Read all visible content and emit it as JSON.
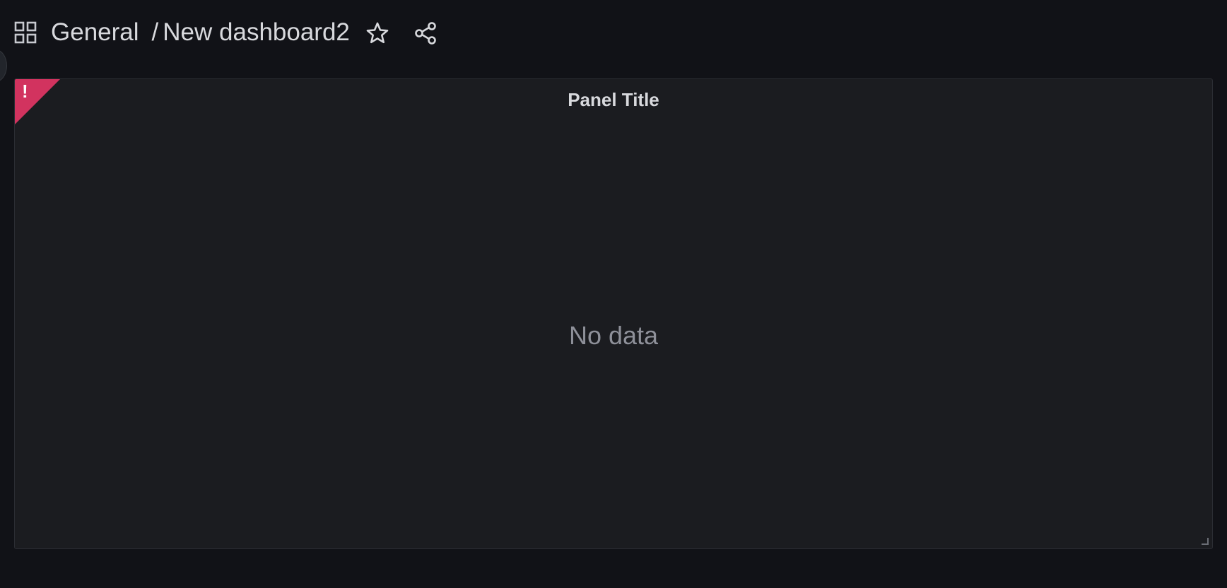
{
  "header": {
    "folder": "General",
    "separator": "/",
    "title": "New dashboard2",
    "icons": {
      "apps": "grid-icon",
      "star": "star-icon",
      "share": "share-icon"
    }
  },
  "panel": {
    "title": "Panel Title",
    "empty_message": "No data",
    "error_indicator": "!",
    "error_color": "#d2335f"
  },
  "colors": {
    "background": "#111217",
    "panel_background": "#1b1c20",
    "text": "#d8d9dd",
    "muted_text": "#8e9099"
  }
}
